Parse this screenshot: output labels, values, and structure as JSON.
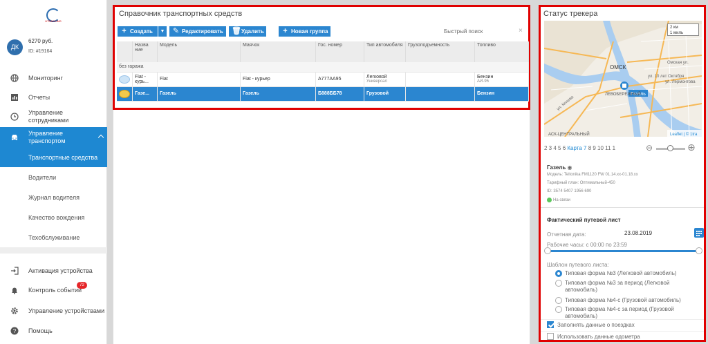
{
  "sidebar": {
    "logo_text": "UTRACKING",
    "avatar": "ДК",
    "balance": "6270 руб.",
    "account_id": "ID: #19164",
    "nav": {
      "monitoring": "Мониторинг",
      "reports": "Отчеты",
      "staff": "Управление сотрудниками",
      "transport": "Управление транспортом",
      "activation": "Активация устройства",
      "events": "Контроль событий",
      "events_badge": "72",
      "devices": "Управление устройствами",
      "help": "Помощь"
    },
    "transport_sub": [
      "Транспортные средства",
      "Водители",
      "Журнал водителя",
      "Качество вождения",
      "Техобслуживание"
    ]
  },
  "main": {
    "title": "Справочник транспортных средств",
    "toolbar": {
      "create": "Создать",
      "edit": "Редактировать",
      "delete": "Удалить",
      "new_group": "Новая группа"
    },
    "search_placeholder": "Быстрый поиск",
    "columns": [
      "Назва ние",
      "Модель",
      "Маячок",
      "Гос. номер",
      "Тип автомобиля",
      "Грузоподъемность",
      "Топливо"
    ],
    "group_row": "без гаража",
    "rows": [
      {
        "name": "Fiat - курь...",
        "model": "Fiat",
        "tracker": "Fiat - курьер",
        "plate": "А777АА95",
        "type": "Легковой",
        "type_sub": "Универсал",
        "capacity": "",
        "fuel": "Бензин",
        "fuel_sub": "АИ-95"
      },
      {
        "name": "Газе...",
        "model": "Газель",
        "tracker": "Газель",
        "plate": "Б888ББ78",
        "type": "Грузовой",
        "type_sub": "",
        "capacity": "",
        "fuel": "Бензин",
        "fuel_sub": ""
      }
    ]
  },
  "right": {
    "title": "Статус трекера",
    "map": {
      "scale_km": "2 км",
      "scale_mi": "1 миль",
      "marker_label": "Газель",
      "labels": {
        "omsk": "ОМСК",
        "omskaya": "Омская ул.",
        "oct": "ул. 10 лет Октября",
        "lermontova": "ул. Лермонтова",
        "koneva": "ул. Конева",
        "center": "ЛЕВОБЕРЕЖНЫЙ",
        "rail": "АСК-ЦЕНТРАЛЬНЫЙ",
        "attr": "Leaflet | © 1tra"
      }
    },
    "zoom": {
      "levels_before": "2 3 4 5 6",
      "current": "Карта 7",
      "levels_after": "8 9 10 11 1"
    },
    "vehicle": {
      "name": "Газель",
      "model": "Модель: Teltonika FM1120 FW 01.14.xx-01.18.xx",
      "plan": "Тарифный план: Оптимальный-450",
      "id": "ID: 3574 5407 1956 690",
      "status": "На связи"
    },
    "waybill": {
      "title": "Фактический путевой лист",
      "date_label": "Отчетная дата:",
      "date_value": "23.08.2019",
      "hours_label": "Рабочие часы: с 00:00 по 23:59",
      "template_label": "Шаблон путевого листа:",
      "options": [
        "Типовая форма №3 (Легковой автомобиль)",
        "Типовая форма №3 за период (Легковой автомобиль)",
        "Типовая форма №4-с (Грузовой автомобиль)",
        "Типовая форма №4-с за период (Грузовой автомобиль)"
      ],
      "check_trips": "Заполнять данные о поездках",
      "check_odometer": "Использовать данные одометра"
    }
  }
}
